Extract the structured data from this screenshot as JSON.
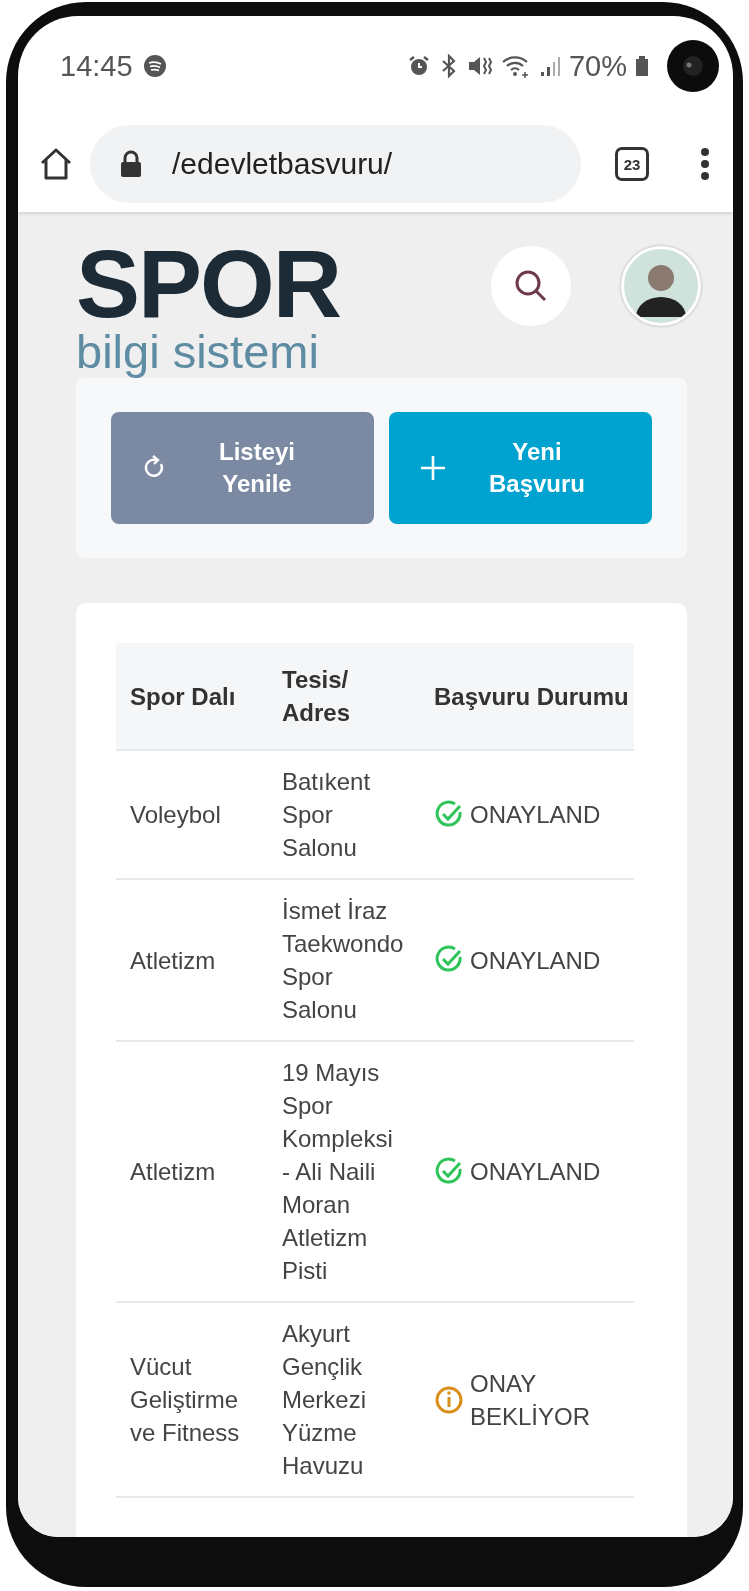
{
  "status_bar": {
    "time": "14:45",
    "battery": "70%"
  },
  "browser": {
    "url": "/edevletbasvuru/",
    "tab_count": "23"
  },
  "logo": {
    "title": "SPOR",
    "subtitle": "bilgi sistemi"
  },
  "actions": [
    {
      "label": "Listeyi Yenile",
      "kind": "refresh"
    },
    {
      "label": "Yeni Başvuru",
      "kind": "add"
    }
  ],
  "table": {
    "columns": [
      "Spor Dalı",
      "Tesis/ Adres",
      "Başvuru Durumu"
    ],
    "rows": [
      {
        "sport": "Voleybol",
        "facility": "Batıkent Spor Salonu",
        "status": "ONAYLAND",
        "kind": "approved"
      },
      {
        "sport": "Atletizm",
        "facility": "İsmet İraz Taekwondo Spor Salonu",
        "status": "ONAYLAND",
        "kind": "approved"
      },
      {
        "sport": "Atletizm",
        "facility": "19 Mayıs Spor Kompleksi - Ali Naili Moran Atletizm Pisti",
        "status": "ONAYLAND",
        "kind": "approved"
      },
      {
        "sport": "Vücut Geliştirme ve Fitness",
        "facility": "Akyurt Gençlik Merkezi Yüzme Havuzu",
        "status": "ONAY BEKLİYOR",
        "kind": "pending"
      }
    ]
  }
}
